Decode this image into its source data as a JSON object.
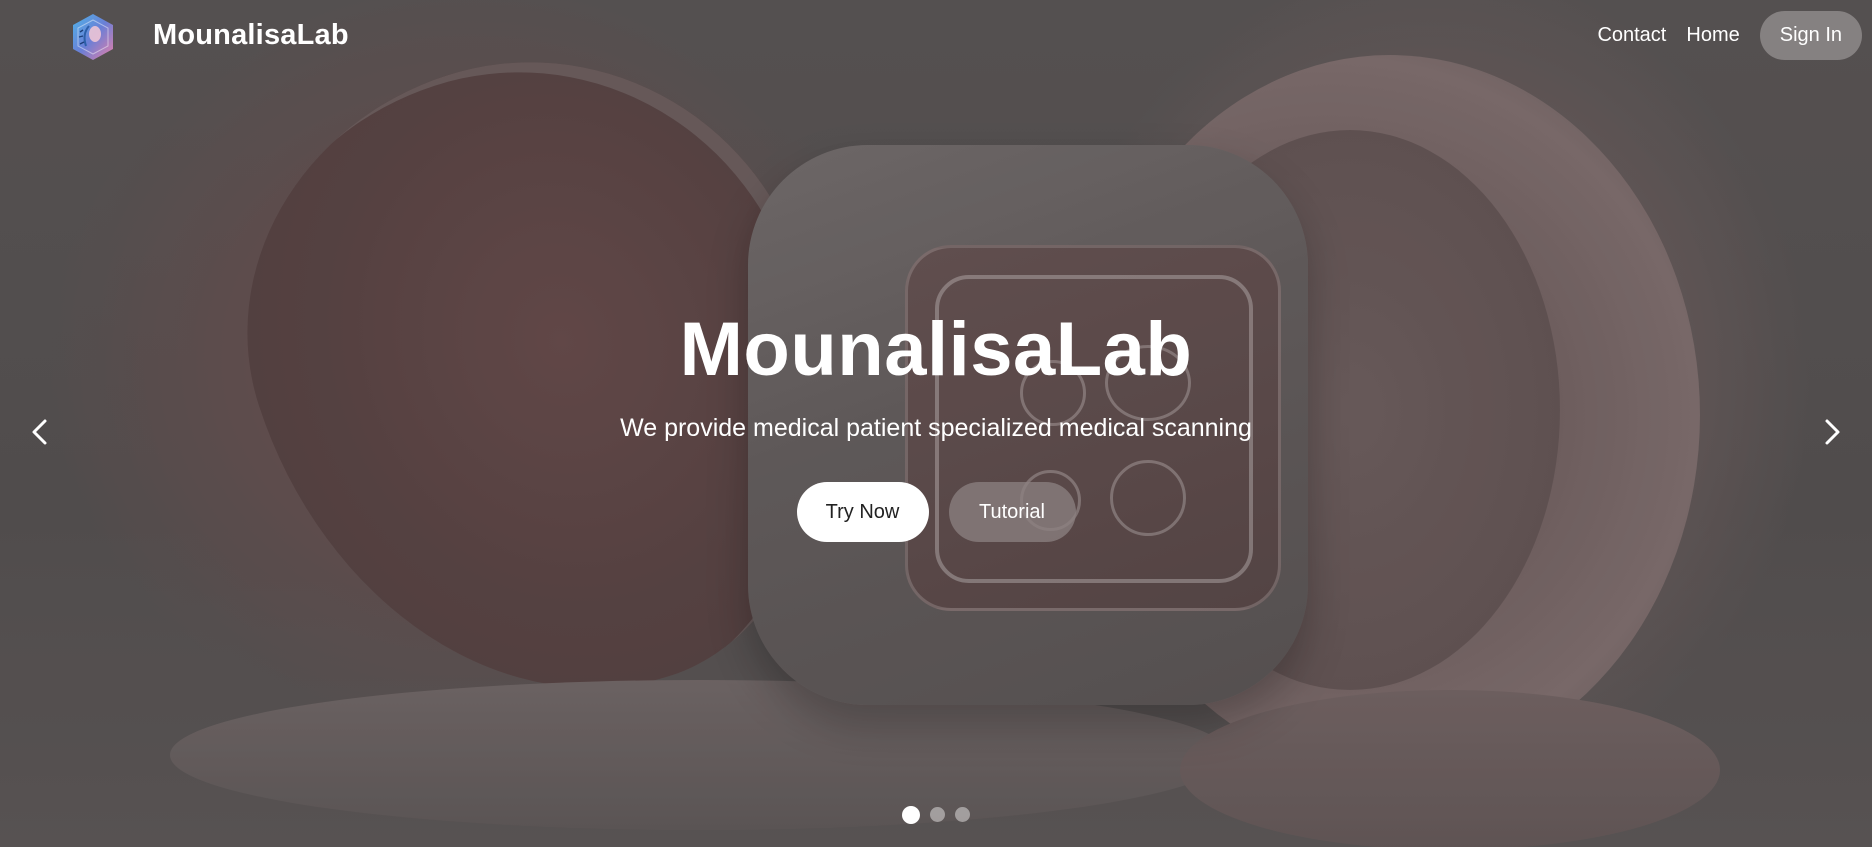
{
  "navbar": {
    "brand": "MounalisaLab",
    "logo_icon": "hexagon-face-logo-icon",
    "links": [
      {
        "label": "Contact"
      },
      {
        "label": "Home"
      }
    ],
    "signin_label": "Sign In"
  },
  "hero": {
    "title": "MounalisaLab",
    "subtitle": "We provide medical patient specialized medical scanning",
    "primary_button": "Try Now",
    "secondary_button": "Tutorial"
  },
  "carousel": {
    "prev_icon": "chevron-left-icon",
    "next_icon": "chevron-right-icon",
    "slide_count": 3,
    "active_slide": 1
  },
  "colors": {
    "overlay": "#5e5a5a",
    "text": "#ffffff",
    "signin_bg": "#969292",
    "primary_button_bg": "#ffffff",
    "secondary_button_bg": "#8c8282"
  }
}
